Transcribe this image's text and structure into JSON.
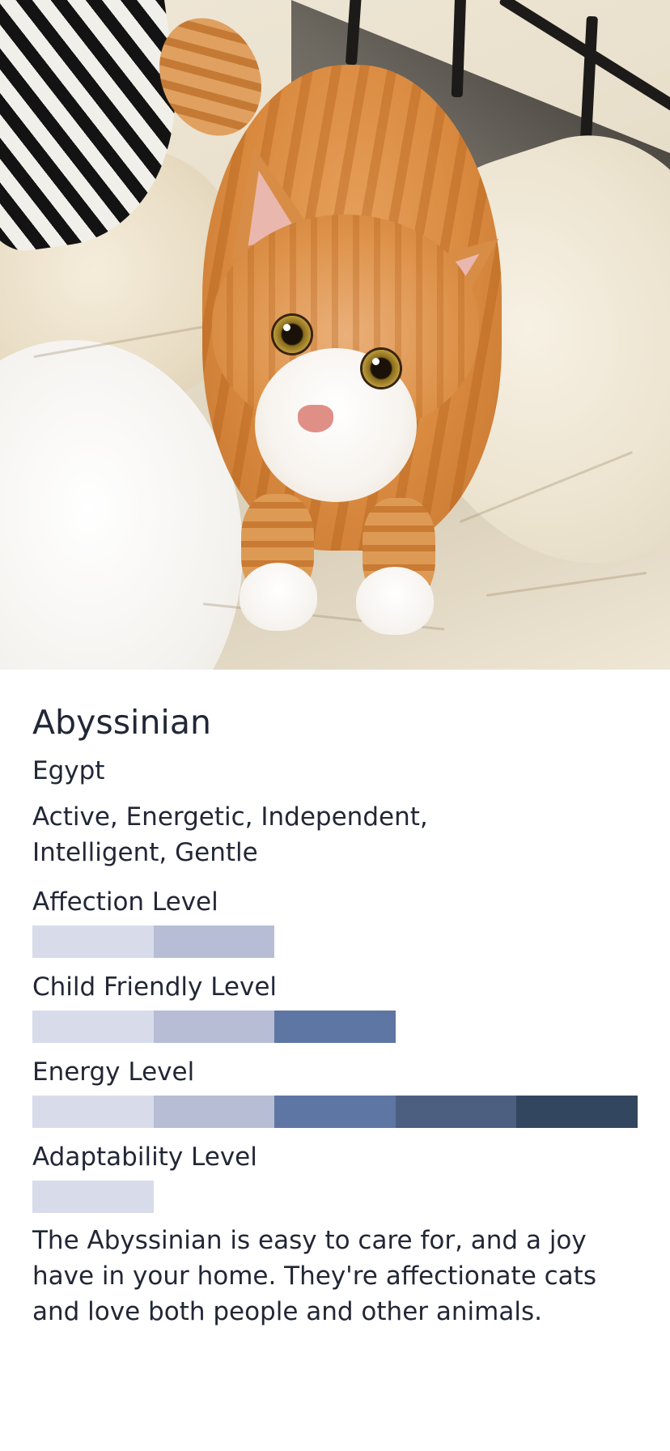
{
  "breed": {
    "name": "Abyssinian",
    "origin": "Egypt",
    "temperament": "Active, Energetic, Independent, Intelligent, Gentle",
    "description": "The Abyssinian is easy to care for, and a joy have in your home. They're affectionate cats and love both people and other animals."
  },
  "photo": {
    "icon": "cat-photo"
  },
  "levels": [
    {
      "label": "Affection Level",
      "value": 2,
      "max": 5
    },
    {
      "label": "Child Friendly Level",
      "value": 3,
      "max": 5
    },
    {
      "label": "Energy Level",
      "value": 5,
      "max": 5
    },
    {
      "label": "Adaptability Level",
      "value": 1,
      "max": 5
    }
  ],
  "colors": {
    "level_segments": [
      "#d8dcea",
      "#b6bdd4",
      "#5e76a3",
      "#4c5f80",
      "#33465f"
    ],
    "text": "#222736",
    "background": "#ffffff"
  }
}
